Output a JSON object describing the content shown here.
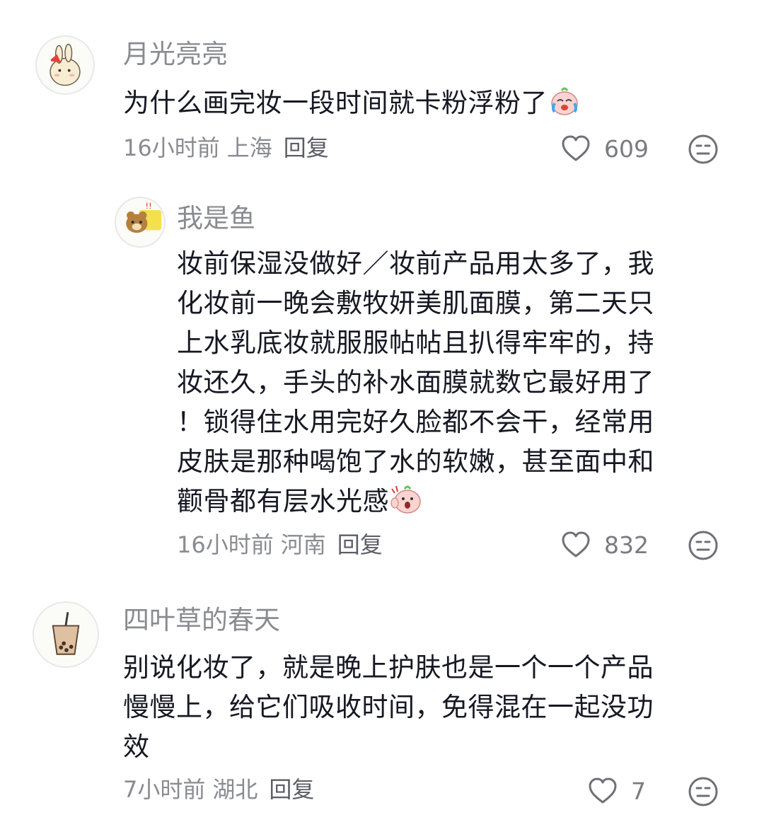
{
  "comments": [
    {
      "username": "月光亮亮",
      "avatar_icon": "bunny-santa-hat-icon",
      "text_lines": [
        "为什么画完妆一段时间就卡粉浮粉了"
      ],
      "emoji": "crying-peach-emoji",
      "time": "16小时前",
      "location": "上海",
      "reply_label": "回复",
      "likes": "609"
    },
    {
      "username": "我是鱼",
      "avatar_icon": "brown-bear-icon",
      "text_lines": [
        "妆前保湿没做好／妆前产品用太多了，我",
        "化妆前一晚会敷牧妍美肌面膜，第二天只",
        "上水乳底妆就服服帖帖且扒得牢牢的，持",
        "妆还久，手头的补水面膜就数它最好用了",
        "！锁得住水用完好久脸都不会干，经常用",
        "皮肤是那种喝饱了水的软嫩，甚至面中和",
        "颧骨都有层水光感"
      ],
      "emoji": "surprised-peach-emoji",
      "time": "16小时前",
      "location": "河南",
      "reply_label": "回复",
      "likes": "832"
    },
    {
      "username": "四叶草的春天",
      "avatar_icon": "bubble-tea-icon",
      "text_lines": [
        "别说化妆了，就是晚上护肤也是一个一个产品",
        "慢慢上，给它们吸收时间，免得混在一起没功",
        "效"
      ],
      "time": "7小时前",
      "location": "湖北",
      "reply_label": "回复",
      "likes": "7"
    }
  ],
  "colors": {
    "text": "#161823",
    "secondary": "#8a8b91",
    "icon": "#6f7077"
  },
  "icons": {
    "like": "heart-outline-icon",
    "dislike": "neutral-face-icon"
  }
}
